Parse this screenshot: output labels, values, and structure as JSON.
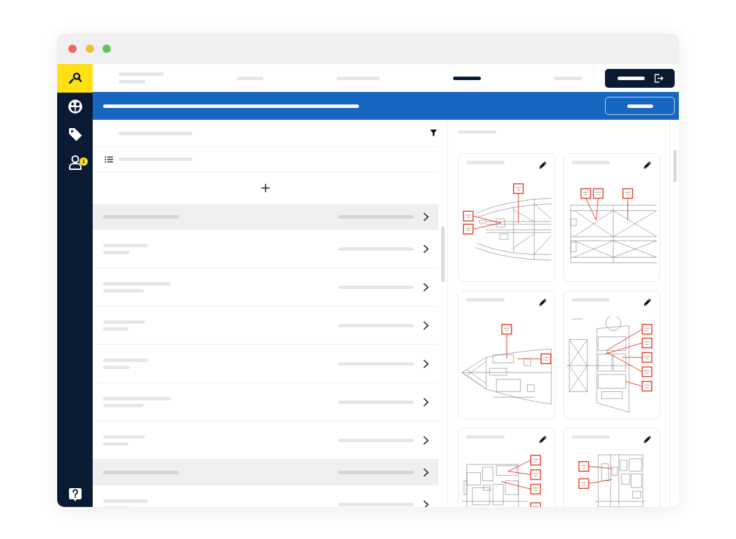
{
  "window": {
    "controls": [
      {
        "color": "#ee6a5f"
      },
      {
        "color": "#f0c02f"
      },
      {
        "color": "#5fc454"
      }
    ]
  },
  "sidebar": {
    "items": [
      {
        "kind": "logo"
      },
      {
        "kind": "link"
      },
      {
        "kind": "link"
      },
      {
        "kind": "link",
        "badge": "1"
      },
      {
        "kind": "help"
      }
    ]
  },
  "top_nav": {
    "tabs": [
      {
        "selected": false
      },
      {
        "selected": false
      },
      {
        "selected": true
      },
      {
        "selected": false
      }
    ]
  },
  "list": {
    "rows": [
      {
        "kind": "group"
      },
      {
        "kind": "item"
      },
      {
        "kind": "item"
      },
      {
        "kind": "item"
      },
      {
        "kind": "item"
      },
      {
        "kind": "item"
      },
      {
        "kind": "item"
      },
      {
        "kind": "group"
      },
      {
        "kind": "item"
      }
    ]
  },
  "drawings": {
    "cards": [
      {
        "kind": "bow"
      },
      {
        "kind": "midship"
      },
      {
        "kind": "hull"
      },
      {
        "kind": "deck"
      },
      {
        "kind": "cabins"
      },
      {
        "kind": "corridor"
      }
    ]
  }
}
